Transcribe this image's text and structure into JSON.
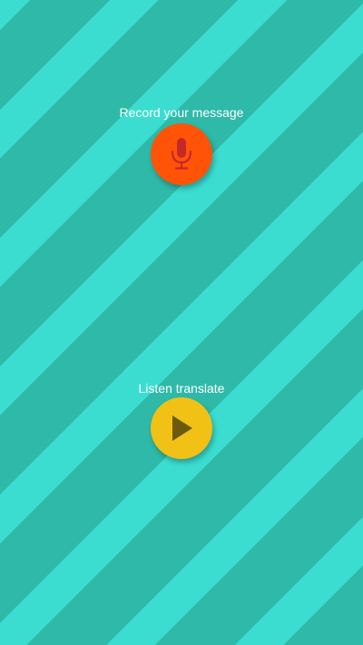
{
  "record": {
    "label": "Record your message",
    "icon": "microphone-icon",
    "button_color": "#ff5407",
    "icon_color": "#c62828"
  },
  "listen": {
    "label": "Listen translate",
    "icon": "play-icon",
    "button_color": "#f2c116",
    "icon_color": "#6b5a0c"
  },
  "background": {
    "stripe_dark": "#2fb9a8",
    "stripe_light": "#3bddd0"
  }
}
